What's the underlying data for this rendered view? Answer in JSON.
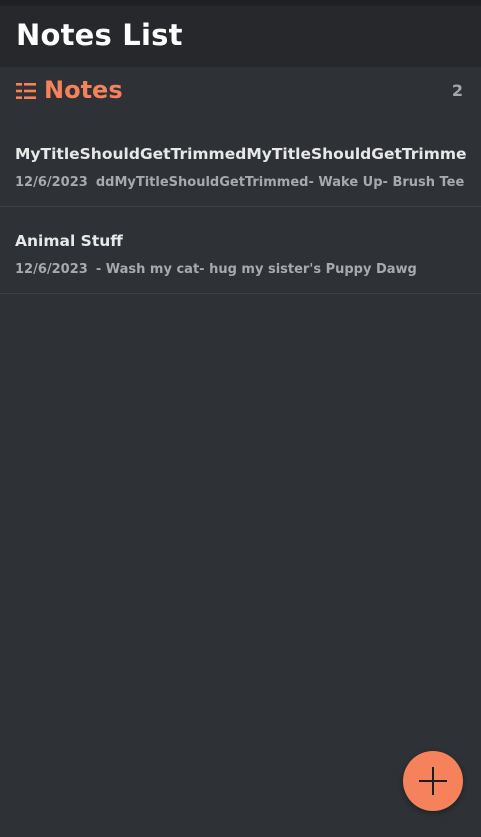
{
  "header": {
    "title": "Notes List"
  },
  "section": {
    "icon": "list-icon",
    "title": "Notes",
    "count": "2"
  },
  "notes": [
    {
      "title": "MyTitleShouldGetTrimmedMyTitleShouldGetTrimme",
      "date": "12/6/2023",
      "preview": "ddMyTitleShouldGetTrimmed- Wake Up- Brush Tee"
    },
    {
      "title": "Animal Stuff",
      "date": "12/6/2023",
      "preview": "- Wash my cat- hug my sister's Puppy Dawg"
    }
  ],
  "fab": {
    "icon": "plus-icon"
  },
  "colors": {
    "accent": "#f5825a",
    "background": "#2e3135",
    "header_background": "#26282b"
  }
}
